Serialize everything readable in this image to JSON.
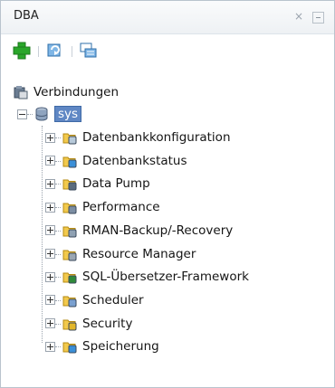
{
  "window": {
    "title": "DBA"
  },
  "toolbar": {
    "add_icon": "plus-icon",
    "refresh_icon": "refresh-icon",
    "filter_icon": "filter-icon"
  },
  "tree": {
    "root": {
      "label": "Verbindungen",
      "icon": "connections-icon"
    },
    "connection": {
      "label": "sys",
      "icon": "database-icon",
      "selected": true
    },
    "items": [
      {
        "label": "Datenbankkonfiguration",
        "icon": "folder-config-icon"
      },
      {
        "label": "Datenbankstatus",
        "icon": "folder-status-icon"
      },
      {
        "label": "Data Pump",
        "icon": "folder-datapump-icon"
      },
      {
        "label": "Performance",
        "icon": "performance-icon"
      },
      {
        "label": "RMAN-Backup/-Recovery",
        "icon": "folder-rman-icon"
      },
      {
        "label": "Resource Manager",
        "icon": "folder-resource-icon"
      },
      {
        "label": "SQL-Übersetzer-Framework",
        "icon": "folder-sql-icon"
      },
      {
        "label": "Scheduler",
        "icon": "folder-scheduler-icon"
      },
      {
        "label": "Security",
        "icon": "folder-security-icon"
      },
      {
        "label": "Speicherung",
        "icon": "folder-storage-icon"
      }
    ]
  },
  "colors": {
    "selection": "#5f87c4",
    "folder": "#f2c94c",
    "add_green": "#2aa62a"
  }
}
